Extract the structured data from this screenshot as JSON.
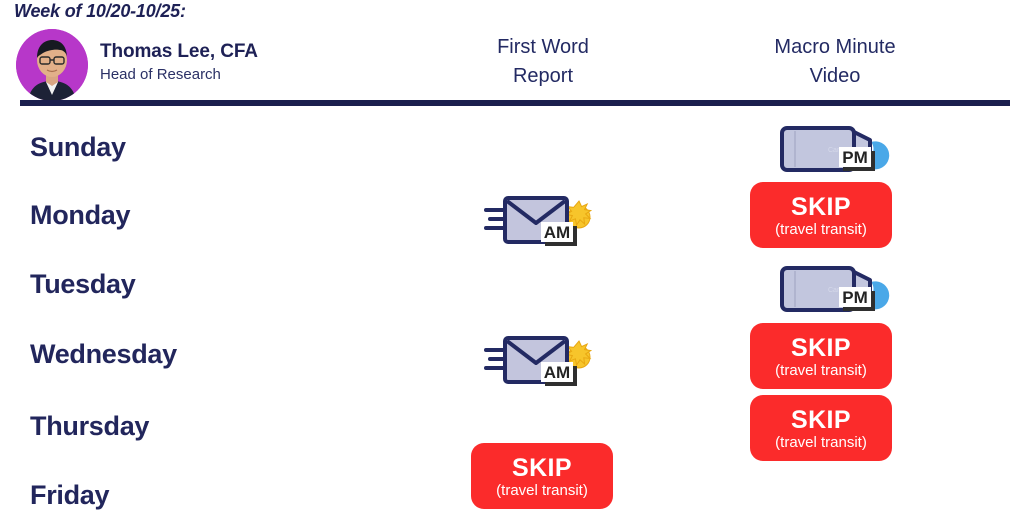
{
  "header": {
    "week_title": "Week of 10/20-10/25:",
    "avatar_bg": "#b737c9",
    "person": {
      "name": "Thomas Lee, CFA",
      "role": "Head of Research"
    },
    "columns": [
      {
        "id": "first-word-report",
        "line1": "First Word",
        "line2": "Report"
      },
      {
        "id": "macro-minute-video",
        "line1": "Macro Minute",
        "line2": "Video"
      }
    ]
  },
  "colors": {
    "navy": "#1e2156",
    "skip_red": "#fb2b2b",
    "avatar_purple": "#b737c9",
    "moon_blue": "#4aa8e8",
    "sun_yellow": "#f7c52b",
    "envelope_fill": "#c3c5dd",
    "camera_fill": "#c2c6de"
  },
  "badges": {
    "skip_label": "SKIP",
    "skip_sub": "(travel transit)",
    "am_label": "AM",
    "pm_label": "PM"
  },
  "icons": {
    "video_pm": "video-camera-pm-moon-icon",
    "mail_am": "envelope-am-sun-icon"
  },
  "schedule": {
    "days": [
      {
        "day": "Sunday",
        "first_word_report": null,
        "macro_minute_video": {
          "kind": "video-pm"
        }
      },
      {
        "day": "Monday",
        "first_word_report": {
          "kind": "mail-am"
        },
        "macro_minute_video": {
          "kind": "skip"
        }
      },
      {
        "day": "Tuesday",
        "first_word_report": null,
        "macro_minute_video": {
          "kind": "video-pm"
        }
      },
      {
        "day": "Wednesday",
        "first_word_report": {
          "kind": "mail-am"
        },
        "macro_minute_video": {
          "kind": "skip"
        }
      },
      {
        "day": "Thursday",
        "first_word_report": null,
        "macro_minute_video": {
          "kind": "skip"
        }
      },
      {
        "day": "Friday",
        "first_word_report": {
          "kind": "skip"
        },
        "macro_minute_video": null
      }
    ]
  }
}
